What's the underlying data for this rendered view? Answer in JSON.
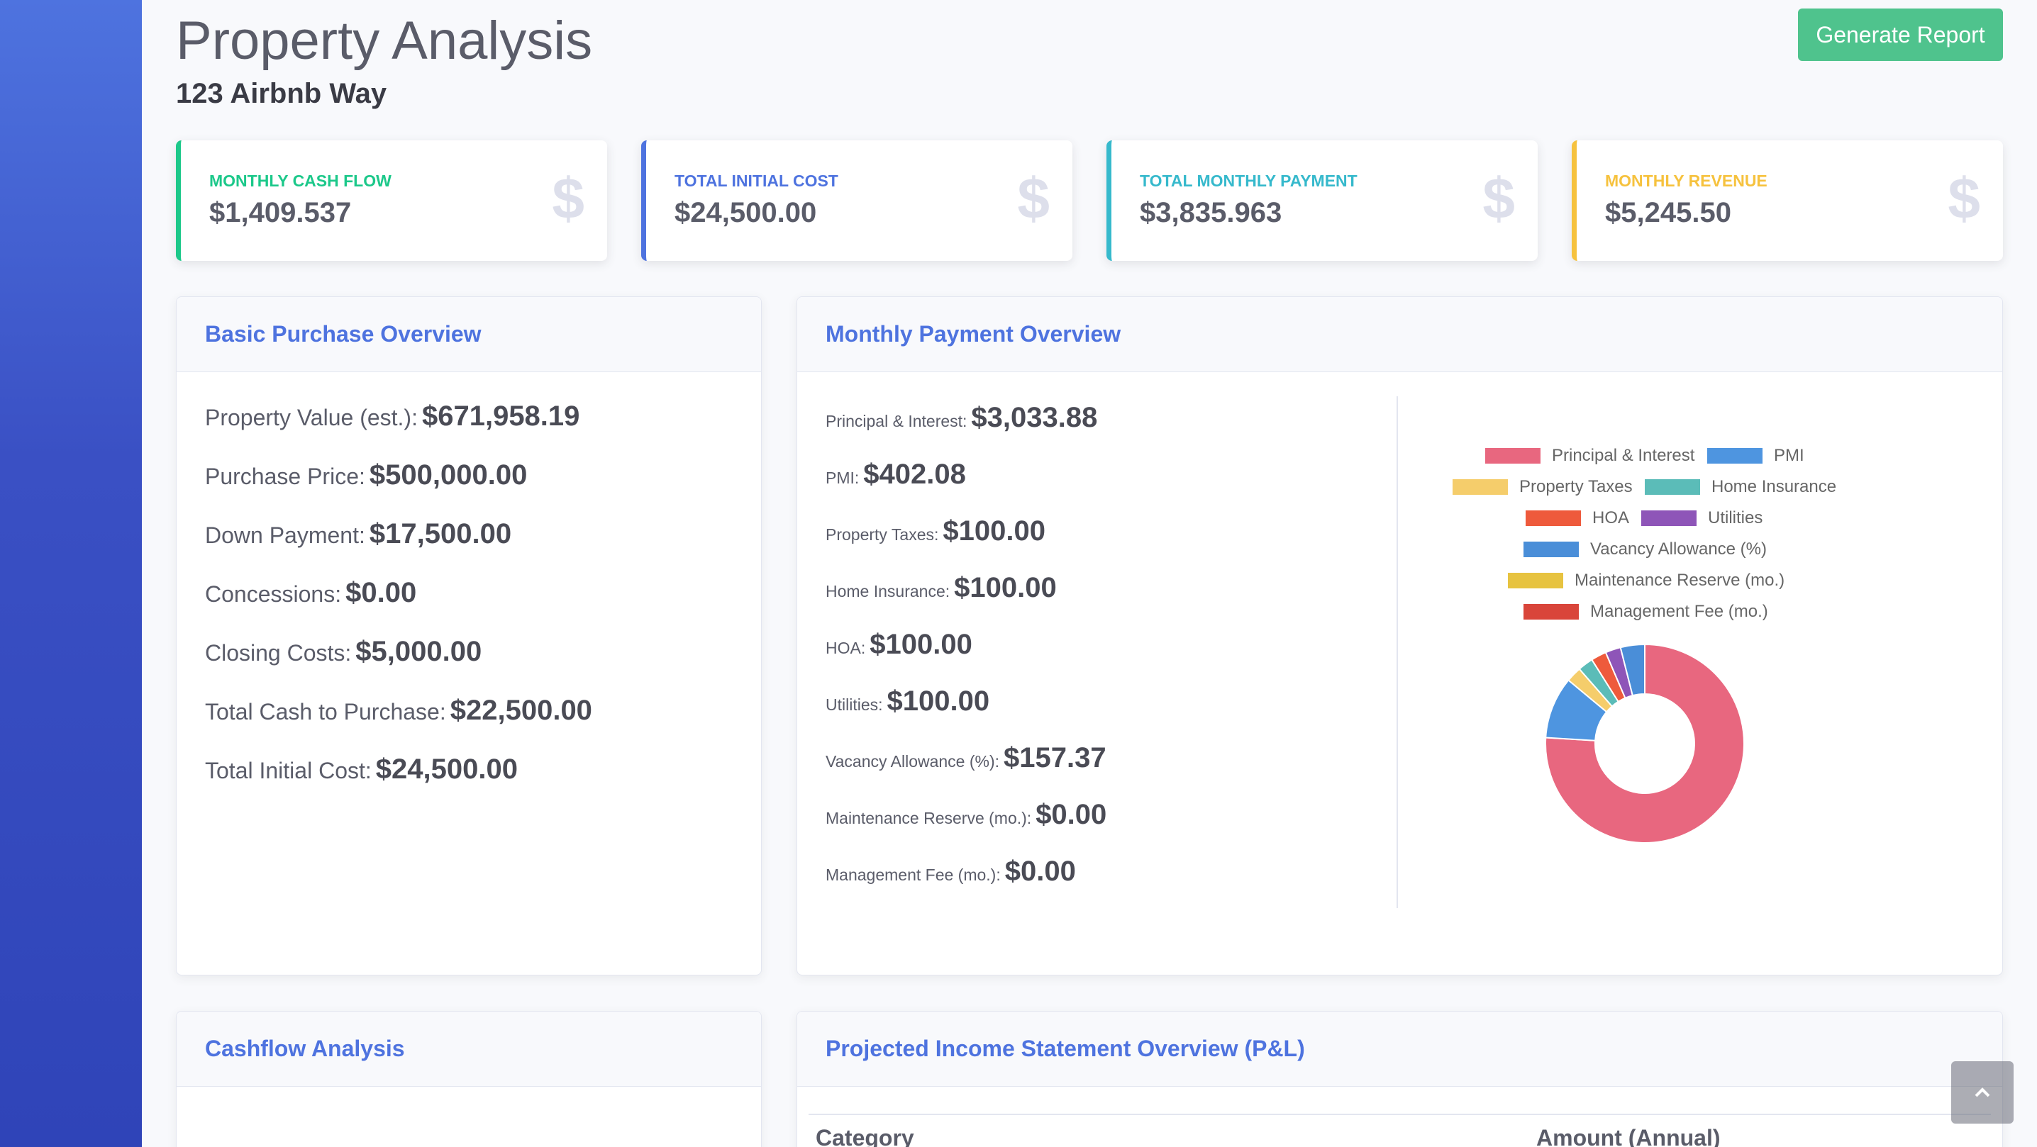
{
  "header": {
    "title": "Property Analysis",
    "subtitle": "123 Airbnb Way",
    "generate_button": "Generate Report"
  },
  "stats": [
    {
      "label": "Monthly Cash Flow",
      "value": "$1,409.537",
      "icon": "$",
      "color": "#1cc88a"
    },
    {
      "label": "Total Initial Cost",
      "value": "$24,500.00",
      "icon": "$",
      "color": "#4e73df"
    },
    {
      "label": "Total Monthly Payment",
      "value": "$3,835.963",
      "icon": "$",
      "color": "#36b9cc"
    },
    {
      "label": "Monthly Revenue",
      "value": "$5,245.50",
      "icon": "$",
      "color": "#f6c23e"
    }
  ],
  "purchase": {
    "title": "Basic Purchase Overview",
    "items": [
      {
        "label": "Property Value (est.):",
        "value": "$671,958.19"
      },
      {
        "label": "Purchase Price:",
        "value": "$500,000.00"
      },
      {
        "label": "Down Payment:",
        "value": "$17,500.00"
      },
      {
        "label": "Concessions:",
        "value": "$0.00"
      },
      {
        "label": "Closing Costs:",
        "value": "$5,000.00"
      },
      {
        "label": "Total Cash to Purchase:",
        "value": "$22,500.00"
      },
      {
        "label": "Total Initial Cost:",
        "value": "$24,500.00"
      }
    ]
  },
  "monthly": {
    "title": "Monthly Payment Overview",
    "items": [
      {
        "label": "Principal & Interest:",
        "value": "$3,033.88"
      },
      {
        "label": "PMI:",
        "value": "$402.08"
      },
      {
        "label": "Property Taxes:",
        "value": "$100.00"
      },
      {
        "label": "Home Insurance:",
        "value": "$100.00"
      },
      {
        "label": "HOA:",
        "value": "$100.00"
      },
      {
        "label": "Utilities:",
        "value": "$100.00"
      },
      {
        "label": "Vacancy Allowance (%):",
        "value": "$157.37"
      },
      {
        "label": "Maintenance Reserve (mo.):",
        "value": "$0.00"
      },
      {
        "label": "Management Fee (mo.):",
        "value": "$0.00"
      }
    ]
  },
  "chart_data": {
    "type": "pie",
    "donut": true,
    "legend_position": "top",
    "categories": [
      "Principal & Interest",
      "PMI",
      "Property Taxes",
      "Home Insurance",
      "HOA",
      "Utilities",
      "Vacancy Allowance (%)",
      "Maintenance Reserve (mo.)",
      "Management Fee (mo.)"
    ],
    "values": [
      3033.88,
      402.08,
      100.0,
      100.0,
      100.0,
      100.0,
      157.37,
      0.0,
      0.0
    ],
    "colors": [
      "#e8677f",
      "#4e95e0",
      "#f5cd6b",
      "#5bbcb8",
      "#ee5a3c",
      "#8e55b8",
      "#4a8ed8",
      "#e7c340",
      "#d9453a"
    ]
  },
  "cashflow": {
    "title": "Cashflow Analysis"
  },
  "pl": {
    "title": "Projected Income Statement Overview (P&L)",
    "columns": [
      "Category",
      "Amount (Annual)"
    ]
  },
  "scroll_top_icon": "chevron-up"
}
